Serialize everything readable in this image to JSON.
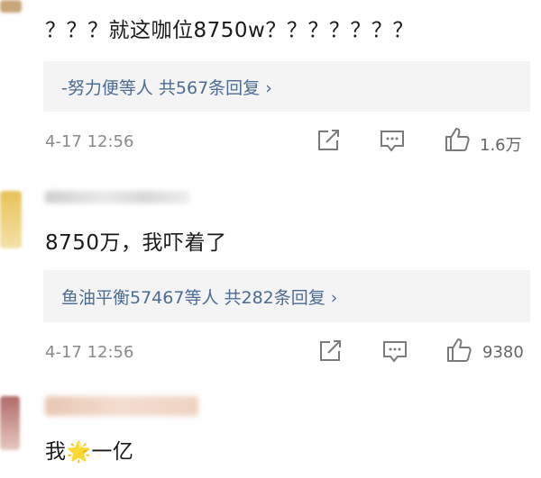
{
  "comments": [
    {
      "text": "？？？就这咖位8750w？？？？？？？",
      "reply_text": "-努力便等人  共567条回复 ›",
      "timestamp": "4-17 12:56",
      "likes": "1.6万"
    },
    {
      "text": "8750万，我吓着了",
      "reply_text": "鱼油平衡57467等人  共282条回复 ›",
      "timestamp": "4-17 12:56",
      "likes": "9380"
    },
    {
      "text_before": "我",
      "emoji": "🌟",
      "text_after": "一亿"
    }
  ],
  "icons": {
    "share": "share-icon",
    "comment": "comment-icon",
    "like": "thumbs-up-icon"
  },
  "colors": {
    "reply_link": "#4d6b94",
    "meta_gray": "#8a8a8a",
    "reply_bg": "#f4f4f4"
  }
}
